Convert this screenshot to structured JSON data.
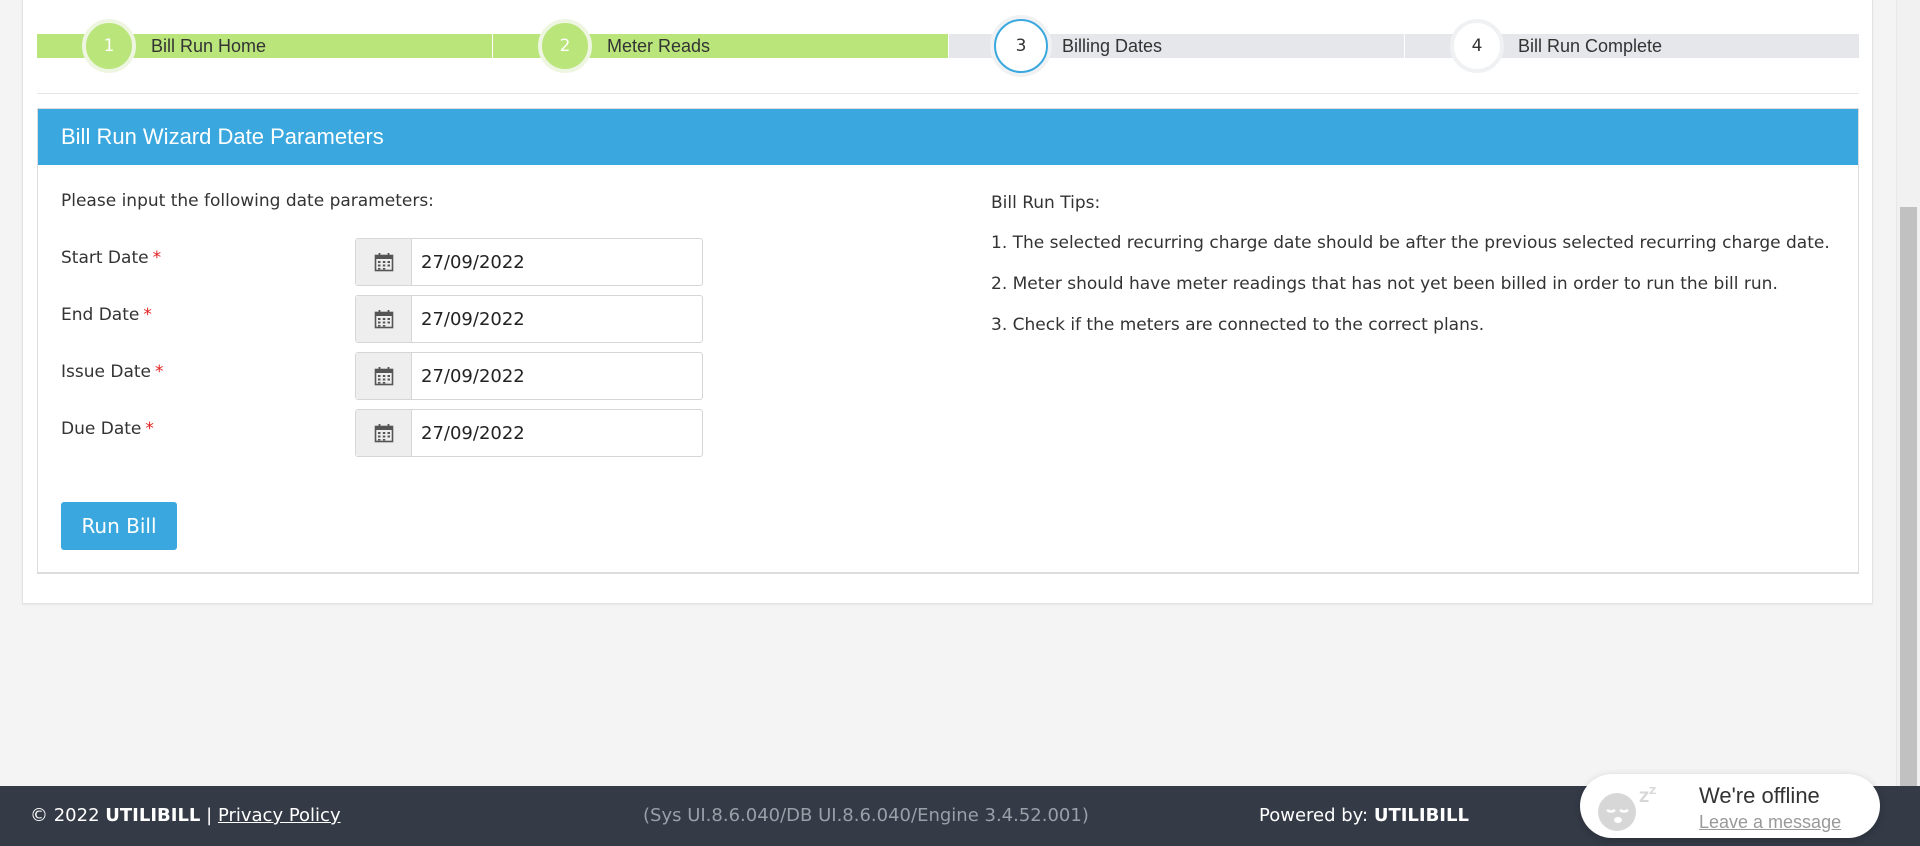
{
  "wizard": {
    "steps": [
      {
        "number": "1",
        "label": "Bill Run Home"
      },
      {
        "number": "2",
        "label": "Meter Reads"
      },
      {
        "number": "3",
        "label": "Billing Dates"
      },
      {
        "number": "4",
        "label": "Bill Run Complete"
      }
    ]
  },
  "panel": {
    "title": "Bill Run Wizard Date Parameters",
    "intro": "Please input the following date parameters:",
    "required_marker": "*",
    "fields": [
      {
        "label": "Start Date",
        "value": "27/09/2022"
      },
      {
        "label": "End Date",
        "value": "27/09/2022"
      },
      {
        "label": "Issue Date",
        "value": "27/09/2022"
      },
      {
        "label": "Due Date",
        "value": "27/09/2022"
      }
    ],
    "run_button": "Run Bill"
  },
  "tips": {
    "title": "Bill Run Tips:",
    "items": [
      "1. The selected recurring charge date should be after the previous selected recurring charge date.",
      "2. Meter should have meter readings that has not yet been billed in order to run the bill run.",
      "3. Check if the meters are connected to the correct plans."
    ]
  },
  "footer": {
    "copyright": "© 2022",
    "brand": "UTILIBILL",
    "separator": "|",
    "privacy": "Privacy Policy",
    "version": "(Sys UI.8.6.040/DB UI.8.6.040/Engine 3.4.52.001)",
    "powered_label": "Powered by:",
    "powered_brand": "UTILIBILL"
  },
  "chat": {
    "status": "We're offline",
    "link": "Leave a message"
  },
  "colors": {
    "accent": "#3aa8df",
    "step_done": "#b9e57a",
    "step_todo": "#e6e7ea",
    "footer_bg": "#343a46",
    "required": "#e02020"
  }
}
